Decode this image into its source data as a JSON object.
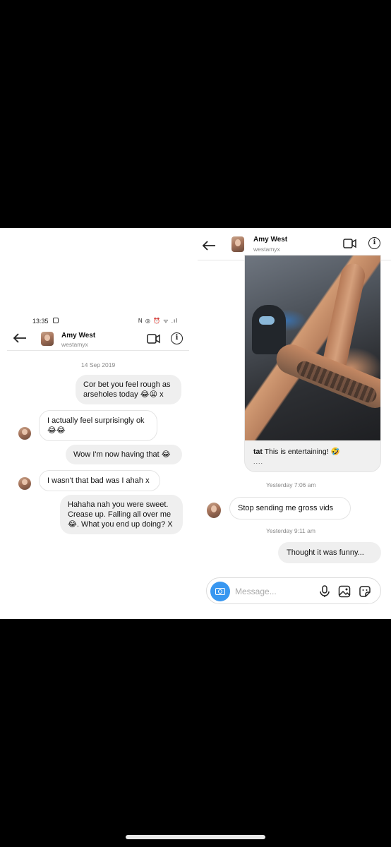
{
  "left_screen": {
    "status_bar": {
      "time": "13:35",
      "system_icons": "N ◎ ⏰ ᯤ .ıl"
    },
    "header": {
      "name": "Amy West",
      "handle": "westamyx",
      "back_icon": "arrow-left-icon",
      "video_icon": "video-camera-icon",
      "info_icon": "info-icon"
    },
    "date_divider": "14 Sep 2019",
    "messages": [
      {
        "sender": "me",
        "text": "Cor bet you feel rough as arseholes today 😂😫 x"
      },
      {
        "sender": "them",
        "text": "I actually feel surprisingly ok 😂😂"
      },
      {
        "sender": "me",
        "text": "Wow I'm now having that 😂"
      },
      {
        "sender": "them",
        "text": "I wasn't that bad was I ahah x"
      },
      {
        "sender": "me",
        "text": "Hahaha nah you were sweet. Crease up. Falling all over me 😂. What you end up doing? X"
      }
    ]
  },
  "right_screen": {
    "header": {
      "name": "Amy West",
      "handle": "westamyx",
      "back_icon": "arrow-left-icon",
      "video_icon": "video-camera-icon",
      "info_icon": "info-icon"
    },
    "shared_post": {
      "username": "tat",
      "caption": "This is entertaining! 🤣",
      "more": "...."
    },
    "timestamps": [
      "Yesterday 7:06 am",
      "Yesterday 9:11 am"
    ],
    "messages": [
      {
        "sender": "them",
        "text": "Stop sending me gross vids"
      },
      {
        "sender": "me",
        "text": "Thought it was funny..."
      }
    ],
    "composer": {
      "placeholder": "Message...",
      "icons": [
        "camera-icon",
        "microphone-icon",
        "gallery-icon",
        "sticker-icon"
      ]
    }
  },
  "colors": {
    "accent": "#3897f0",
    "bubble_me": "#efefef",
    "border": "#e4e4e4",
    "background_outer": "#000000"
  }
}
